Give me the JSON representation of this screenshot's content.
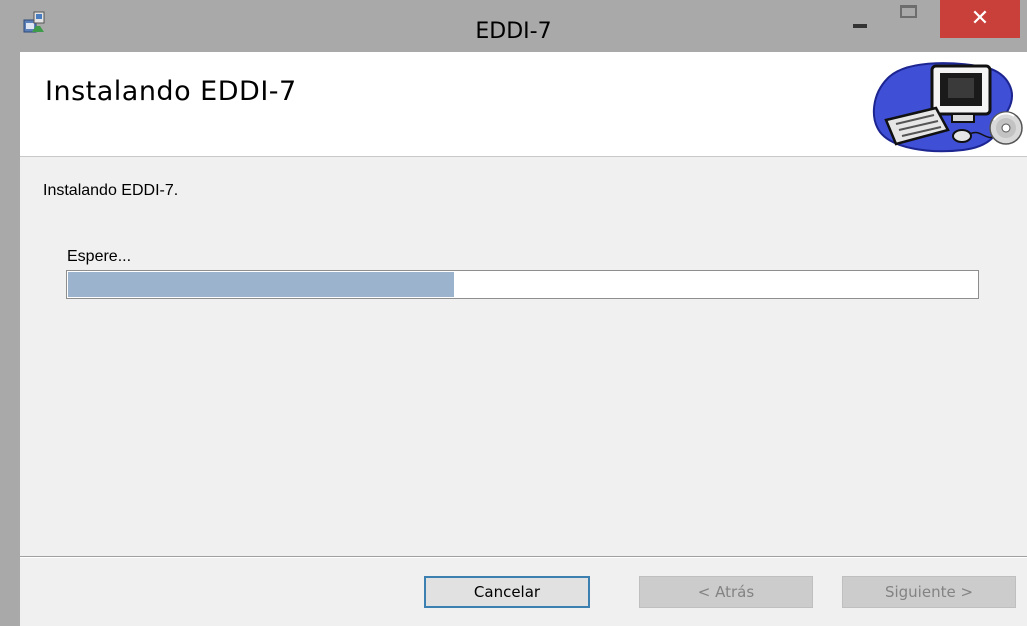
{
  "window": {
    "title": "EDDI-7",
    "close_glyph": "✕",
    "icons": [
      "installer-icon",
      "minimize-icon",
      "maximize-icon",
      "close-icon"
    ]
  },
  "banner": {
    "title": "Instalando EDDI-7",
    "graphic": "computer-with-cd-icon"
  },
  "main": {
    "status": "Instalando EDDI-7.",
    "progress_label": "Espere...",
    "progress_fraction": 0.425
  },
  "buttons": {
    "cancel": "Cancelar",
    "back": "< Atrás",
    "next": "Siguiente >"
  },
  "colors": {
    "progress_fill": "#9cb3cd",
    "close_button": "#c9403a",
    "title_bar": "#a9a9a9"
  }
}
